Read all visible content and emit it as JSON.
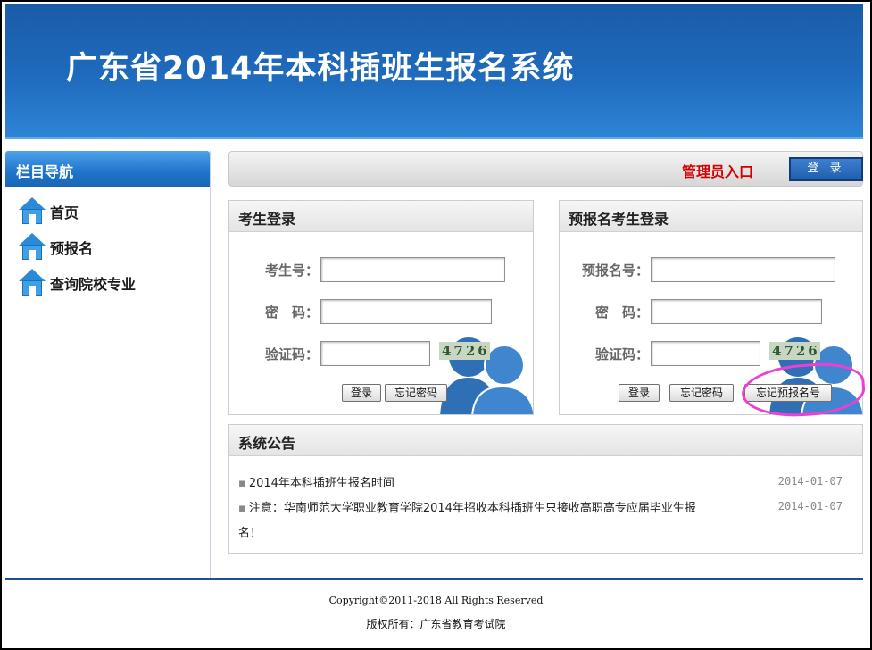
{
  "header": {
    "title": "广东省2014年本科插班生报名系统"
  },
  "sidebar": {
    "title": "栏目导航",
    "items": [
      {
        "label": "首页",
        "icon": "house-icon"
      },
      {
        "label": "预报名",
        "icon": "house-icon"
      },
      {
        "label": "查询院校专业",
        "icon": "house-icon"
      }
    ]
  },
  "topbar": {
    "admin_label": "管理员入口",
    "login_button": "登 录"
  },
  "student_login": {
    "title": "考生登录",
    "id_label": "考生号：",
    "id_value": "",
    "password_label": "密　码：",
    "password_value": "",
    "captcha_label": "验证码：",
    "captcha_value": "",
    "captcha_image_text": "4726",
    "login_button": "登录",
    "forgot_password_button": "忘记密码"
  },
  "prereg_login": {
    "title": "预报名考生登录",
    "id_label": "预报名号：",
    "id_value": "",
    "password_label": "密　码：",
    "password_value": "",
    "captcha_label": "验证码：",
    "captcha_value": "",
    "captcha_image_text": "4726",
    "login_button": "登录",
    "forgot_password_button": "忘记密码",
    "forgot_prereg_button": "忘记预报名号"
  },
  "announcements": {
    "title": "系统公告",
    "items": [
      {
        "text": "2014年本科插班生报名时间",
        "date": "2014-01-07"
      },
      {
        "text": "注意：华南师范大学职业教育学院2014年招收本科插班生只接收高职高专应届毕业生报",
        "text_cont": "名！",
        "date": "2014-01-07"
      }
    ]
  },
  "footer": {
    "copyright": "Copyright©2011-2018 All Rights Reserved",
    "owner": "版权所有：广东省教育考试院"
  },
  "colors": {
    "header": "#1f6bbd",
    "admin_red": "#d20000",
    "annotation": "#ee3fd3",
    "footer_line": "#1f4f8c"
  }
}
